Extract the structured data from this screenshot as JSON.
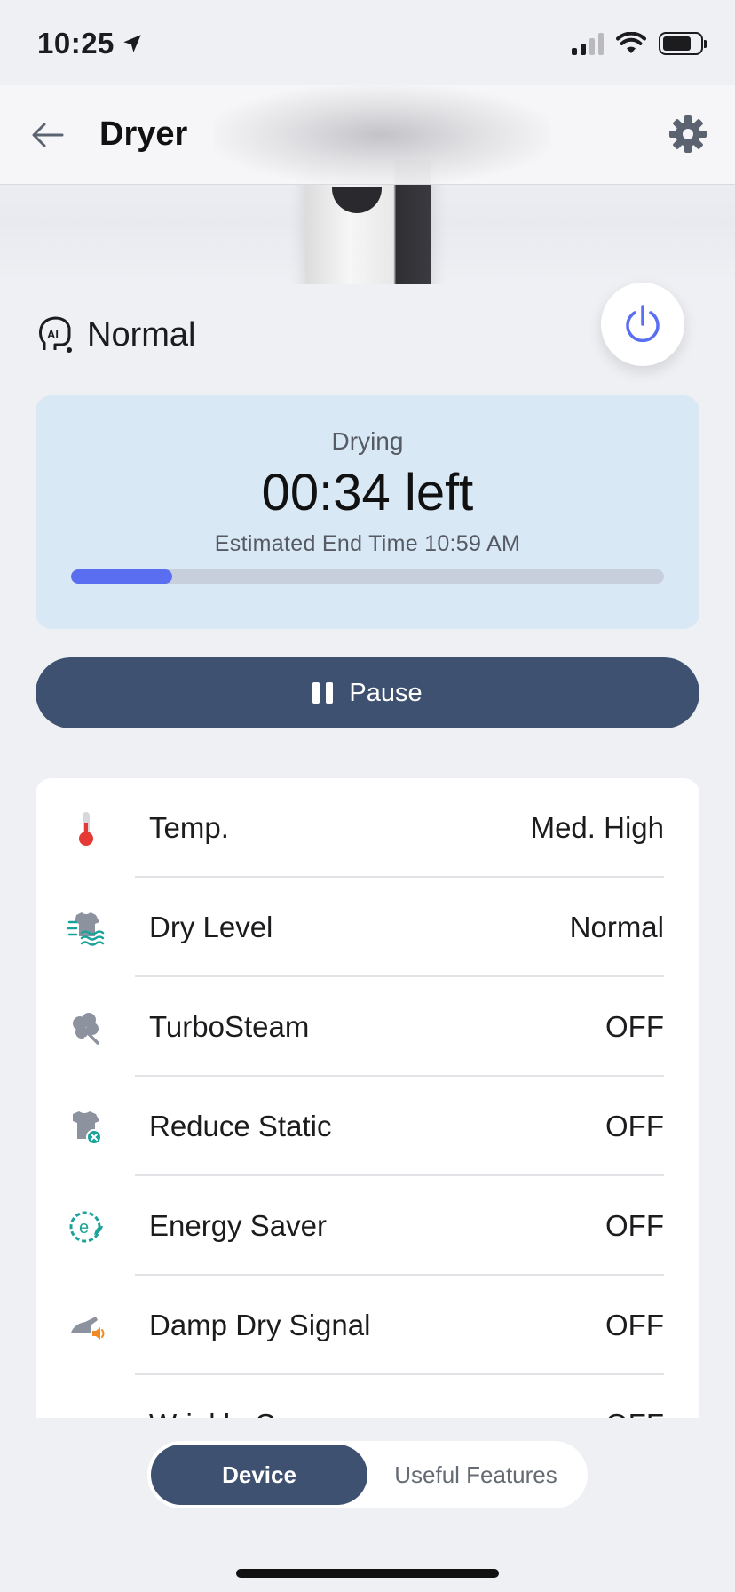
{
  "status_bar": {
    "time": "10:25"
  },
  "header": {
    "title": "Dryer"
  },
  "mode": {
    "label": "Normal"
  },
  "status": {
    "state": "Drying",
    "remaining": "00:34 left",
    "end_time": "Estimated End Time 10:59 AM",
    "progress_percent": 17
  },
  "pause_label": "Pause",
  "settings": [
    {
      "name": "Temp.",
      "value": "Med. High",
      "icon": "thermometer-icon"
    },
    {
      "name": "Dry Level",
      "value": "Normal",
      "icon": "dry-level-icon"
    },
    {
      "name": "TurboSteam",
      "value": "OFF",
      "icon": "turbosteam-icon"
    },
    {
      "name": "Reduce Static",
      "value": "OFF",
      "icon": "reduce-static-icon"
    },
    {
      "name": "Energy Saver",
      "value": "OFF",
      "icon": "energy-saver-icon"
    },
    {
      "name": "Damp Dry Signal",
      "value": "OFF",
      "icon": "damp-dry-signal-icon"
    },
    {
      "name": "Wrinkle Care",
      "value": "OFF",
      "icon": "wrinkle-care-icon"
    }
  ],
  "tabs": {
    "device": "Device",
    "useful_features": "Useful Features"
  },
  "colors": {
    "accent": "#5a6ef2",
    "navy": "#3f5170",
    "status_card": "#d9e8f5"
  }
}
